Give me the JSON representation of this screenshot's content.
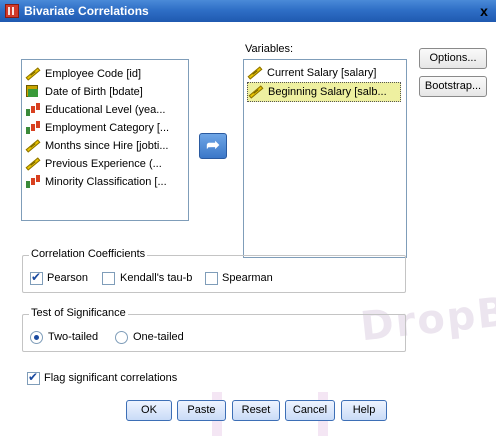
{
  "window": {
    "title": "Bivariate Correlations",
    "close": "x"
  },
  "source_list": [
    {
      "label": "Employee Code [id]",
      "icon": "scale-icon"
    },
    {
      "label": "Date of Birth [bdate]",
      "icon": "date-icon"
    },
    {
      "label": "Educational Level (yea...",
      "icon": "bar-icon"
    },
    {
      "label": "Employment Category [...",
      "icon": "bar-icon"
    },
    {
      "label": "Months since Hire [jobti...",
      "icon": "scale-icon"
    },
    {
      "label": "Previous Experience (...",
      "icon": "scale-icon"
    },
    {
      "label": "Minority Classification [...",
      "icon": "bar-icon"
    }
  ],
  "variables": {
    "label": "Variables:",
    "items": [
      {
        "label": "Current Salary [salary]",
        "icon": "scale-icon"
      },
      {
        "label": "Beginning Salary [salb...",
        "icon": "scale-icon",
        "selected": true
      }
    ]
  },
  "side_buttons": {
    "options": "Options...",
    "bootstrap": "Bootstrap..."
  },
  "correlation": {
    "title": "Correlation Coefficients",
    "pearson": "Pearson",
    "pearson_checked": true,
    "kendall": "Kendall's tau-b",
    "kendall_checked": false,
    "spearman": "Spearman",
    "spearman_checked": false
  },
  "significance": {
    "title": "Test of Significance",
    "two_tailed": "Two-tailed",
    "two_tailed_selected": true,
    "one_tailed": "One-tailed",
    "one_tailed_selected": false
  },
  "flag": {
    "label": "Flag significant correlations",
    "checked": true
  },
  "buttons": {
    "ok": "OK",
    "paste": "Paste",
    "reset": "Reset",
    "cancel": "Cancel",
    "help": "Help"
  },
  "watermark": "DropBook"
}
